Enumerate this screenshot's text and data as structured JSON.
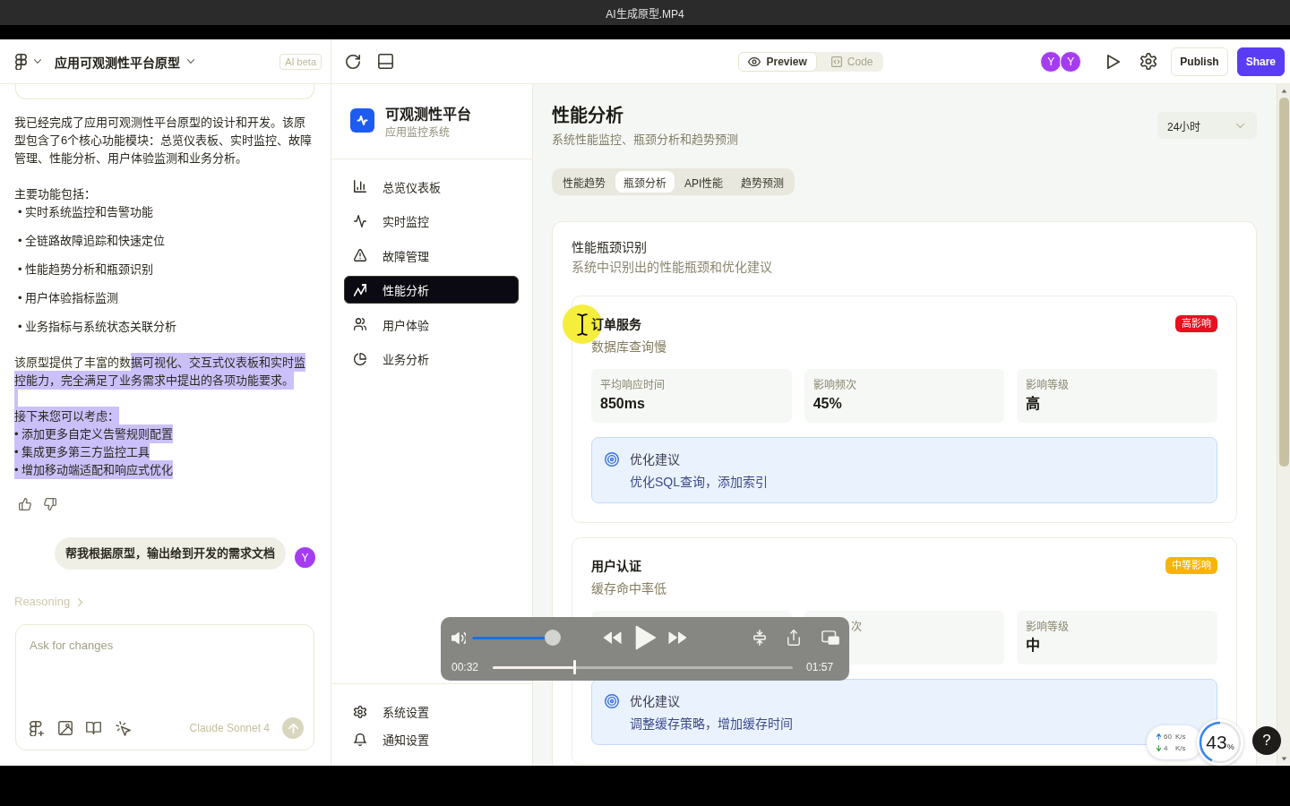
{
  "player": {
    "title": "AI生成原型.MP4",
    "volume": {
      "level": 1
    },
    "elapsed": "00:32",
    "progress": {
      "level": 0.27
    },
    "duration": "01:57"
  },
  "header": {
    "project_title": "应用可观测性平台原型",
    "badge": "AI beta",
    "view_modes": [
      {
        "label": "Preview",
        "selected": true
      },
      {
        "label": "Code",
        "selected": false
      }
    ],
    "collaborators": [
      "Y",
      "Y"
    ],
    "actions": [
      {
        "label": "Publish",
        "kind": "secondary"
      },
      {
        "label": "Share",
        "kind": "primary"
      }
    ]
  },
  "chat": {
    "intro": "我已经完成了应用可观测性平台原型的设计和开发。该原型包含了6个核心功能模块：总览仪表板、实时监控、故障管理、性能分析、用户体验监测和业务分析。",
    "features_heading": "主要功能包括：",
    "features": [
      "• 实时系统监控和告警功能",
      "• 全链路故障追踪和快速定位",
      "• 性能趋势分析和瓶颈识别",
      "• 用户体验指标监测",
      "• 业务指标与系统状态关联分析"
    ],
    "closing": [
      {
        "kind": "text",
        "parts": [
          {
            "text": "该原型提供了丰富的数",
            "selected": false
          },
          {
            "text": "据可视化、交互式仪表板和实时监控能力，完全满足了业务需求中提出的各项功能要求。",
            "selected": true
          }
        ]
      },
      {
        "kind": "blank",
        "selected": true
      },
      {
        "kind": "text",
        "parts": [
          {
            "text": "接下来您可以考虑：",
            "selected": true
          }
        ]
      },
      {
        "kind": "text",
        "parts": [
          {
            "text": "• 添加更多自定义告警规则配置",
            "selected": true
          }
        ]
      },
      {
        "kind": "text",
        "parts": [
          {
            "text": "• 集成更多第三方监控工具",
            "selected": true
          }
        ]
      },
      {
        "kind": "text",
        "parts": [
          {
            "text": "• 增加移动端适配和响应式优化",
            "selected": true
          }
        ]
      }
    ],
    "user_message": {
      "text": "帮我根据原型，输出给到开发的需求文档",
      "avatar": "Y"
    },
    "reasoning": {
      "label": "Reasoning",
      "expanded": false
    },
    "composer": {
      "placeholder": "Ask for changes",
      "model": "Claude Sonnet 4",
      "send_disabled": true
    }
  },
  "app": {
    "brand": {
      "name": "可观测性平台",
      "subtitle": "应用监控系统"
    },
    "nav": [
      {
        "label": "总览仪表板",
        "selected": false
      },
      {
        "label": "实时监控",
        "selected": false
      },
      {
        "label": "故障管理",
        "selected": false
      },
      {
        "label": "性能分析",
        "selected": true
      },
      {
        "label": "用户体验",
        "selected": false
      },
      {
        "label": "业务分析",
        "selected": false
      }
    ],
    "footer_nav": [
      "系统设置",
      "通知设置"
    ],
    "page": {
      "title": "性能分析",
      "subtitle": "系统性能监控、瓶颈分析和趋势预测",
      "time_range": "24小时",
      "tabs": [
        {
          "label": "性能趋势",
          "selected": false
        },
        {
          "label": "瓶颈分析",
          "selected": true
        },
        {
          "label": "API性能",
          "selected": false
        },
        {
          "label": "趋势预测",
          "selected": false
        }
      ]
    },
    "panel": {
      "title": "性能瓶颈识别",
      "subtitle": "系统中识别出的性能瓶颈和优化建议",
      "bottlenecks": [
        {
          "service": "订单服务",
          "issue": "数据库查询慢",
          "impact": {
            "label": "高影响",
            "color": "#e8101f"
          },
          "metrics": [
            {
              "kind": "full",
              "label": "平均响应时间",
              "value": "850ms"
            },
            {
              "kind": "full",
              "label": "影响频次",
              "value": "45%"
            },
            {
              "kind": "full",
              "label": "影响等级",
              "value": "高"
            }
          ],
          "suggestion": {
            "title": "优化建议",
            "text": "优化SQL查询，添加索引"
          }
        },
        {
          "service": "用户认证",
          "issue": "缓存命中率低",
          "impact": {
            "label": "中等影响",
            "color": "#f7b500"
          },
          "metrics": [
            {
              "kind": "hidden"
            },
            {
              "kind": "cut",
              "label": "次"
            },
            {
              "kind": "full",
              "label": "影响等级",
              "value": "中"
            }
          ],
          "suggestion": {
            "title": "优化建议",
            "text": "调整缓存策略，增加缓存时间"
          }
        }
      ]
    }
  },
  "overlays": {
    "network": {
      "upload": {
        "value": "60",
        "unit": "K/s"
      },
      "download": {
        "value": "4",
        "unit": "K/s"
      }
    },
    "usage": {
      "value": "43",
      "unit": "%",
      "level": 0.43
    },
    "help": "?"
  }
}
